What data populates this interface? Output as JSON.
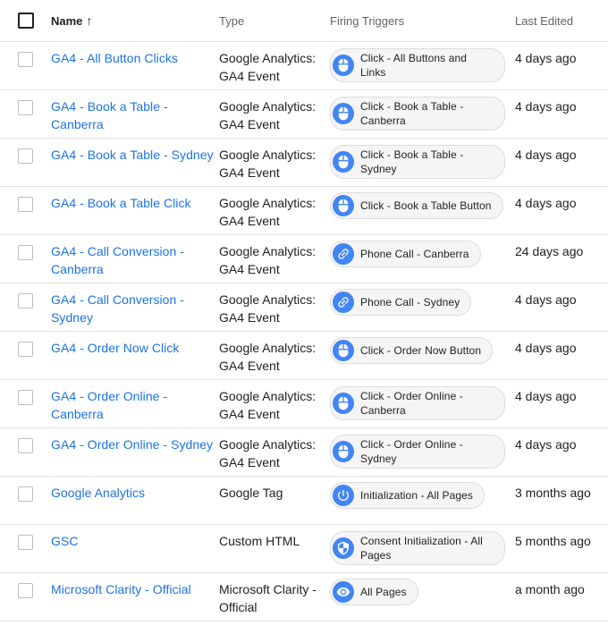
{
  "columns": {
    "name": "Name",
    "sort_arrow": "↑",
    "type": "Type",
    "triggers": "Firing Triggers",
    "edited": "Last Edited"
  },
  "rows": [
    {
      "name": "GA4 - All Button Clicks",
      "type": "Google Analytics: GA4 Event",
      "trigger": "Click - All Buttons and Links",
      "trigger_icon": "mouse-icon",
      "edited": "4 days ago"
    },
    {
      "name": "GA4 - Book a Table - Canberra",
      "type": "Google Analytics: GA4 Event",
      "trigger": "Click - Book a Table - Canberra",
      "trigger_icon": "mouse-icon",
      "edited": "4 days ago"
    },
    {
      "name": "GA4 - Book a Table - Sydney",
      "type": "Google Analytics: GA4 Event",
      "trigger": "Click - Book a Table - Sydney",
      "trigger_icon": "mouse-icon",
      "edited": "4 days ago"
    },
    {
      "name": "GA4 - Book a Table Click",
      "type": "Google Analytics: GA4 Event",
      "trigger": "Click - Book a Table Button",
      "trigger_icon": "mouse-icon",
      "edited": "4 days ago"
    },
    {
      "name": "GA4 - Call Conversion - Canberra",
      "type": "Google Analytics: GA4 Event",
      "trigger": "Phone Call - Canberra",
      "trigger_icon": "link-icon",
      "edited": "24 days ago"
    },
    {
      "name": "GA4 - Call Conversion - Sydney",
      "type": "Google Analytics: GA4 Event",
      "trigger": "Phone Call - Sydney",
      "trigger_icon": "link-icon",
      "edited": "4 days ago"
    },
    {
      "name": "GA4 - Order Now Click",
      "type": "Google Analytics: GA4 Event",
      "trigger": "Click - Order Now Button",
      "trigger_icon": "mouse-icon",
      "edited": "4 days ago"
    },
    {
      "name": "GA4 - Order Online - Canberra",
      "type": "Google Analytics: GA4 Event",
      "trigger": "Click - Order Online - Canberra",
      "trigger_icon": "mouse-icon",
      "edited": "4 days ago"
    },
    {
      "name": "GA4 - Order Online - Sydney",
      "type": "Google Analytics: GA4 Event",
      "trigger": "Click - Order Online - Sydney",
      "trigger_icon": "mouse-icon",
      "edited": "4 days ago"
    },
    {
      "name": "Google Analytics",
      "type": "Google Tag",
      "trigger": "Initialization - All Pages",
      "trigger_icon": "power-icon",
      "edited": "3 months ago"
    },
    {
      "name": "GSC",
      "type": "Custom HTML",
      "trigger": "Consent Initialization - All Pages",
      "trigger_icon": "shield-icon",
      "edited": "5 months ago"
    },
    {
      "name": "Microsoft Clarity - Official",
      "type": "Microsoft Clarity - Official",
      "trigger": "All Pages",
      "trigger_icon": "eye-icon",
      "edited": "a month ago"
    }
  ],
  "colors": {
    "link": "#1a73e8",
    "chip_icon_bg": "#4285f4"
  }
}
